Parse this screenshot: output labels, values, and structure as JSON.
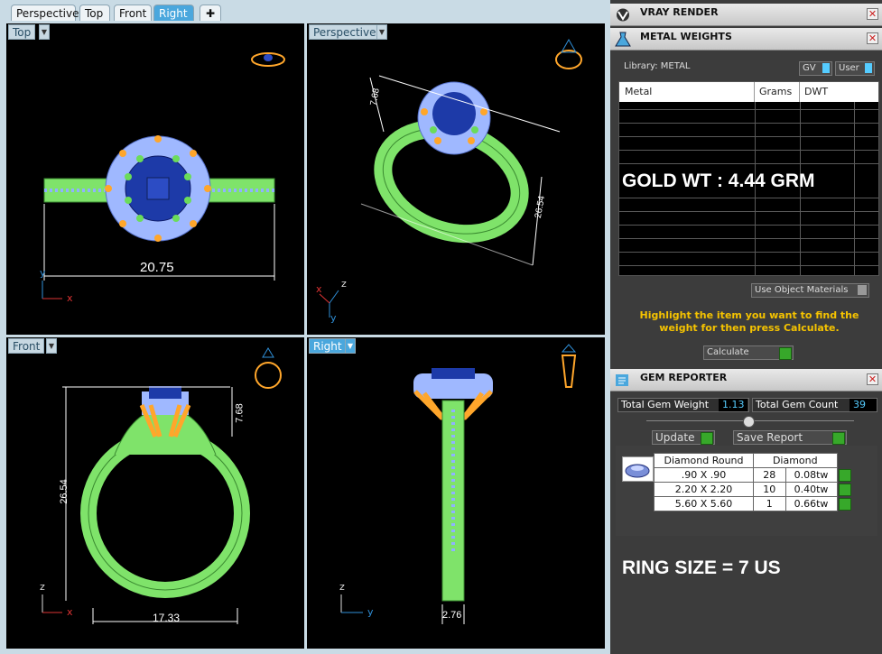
{
  "tabs": [
    {
      "label": "Perspective"
    },
    {
      "label": "Top"
    },
    {
      "label": "Front"
    },
    {
      "label": "Right"
    },
    {
      "label": "✚"
    }
  ],
  "viewports": {
    "top": {
      "label": "Top",
      "dim": "20.75",
      "axis_x": "x",
      "axis_y": "y"
    },
    "perspective": {
      "label": "Perspective",
      "dim_a": "7.68",
      "dim_b": "26.54",
      "axis_x": "x",
      "axis_y": "y",
      "axis_z": "z"
    },
    "front": {
      "label": "Front",
      "dim_height": "26.54",
      "dim_top": "7.68",
      "dim_width": "17.33",
      "axis_x": "x",
      "axis_z": "z"
    },
    "right": {
      "label": "Right",
      "dim_width": "2.76",
      "axis_y": "y",
      "axis_z": "z"
    }
  },
  "vray": {
    "title": "VRAY RENDER",
    "close": "✕"
  },
  "metal": {
    "title": "METAL WEIGHTS",
    "close": "✕",
    "library": "Library: METAL",
    "gv": "GV",
    "user": "User",
    "headers": [
      "Metal",
      "Grams",
      "DWT"
    ],
    "use_object": "Use Object Materials",
    "hint": "Highlight the item you want to find the weight for then press Calculate.",
    "calculate": "Calculate"
  },
  "gem": {
    "title": "GEM REPORTER",
    "close": "✕",
    "total_weight_label": "Total Gem Weight",
    "total_weight": "1.13",
    "total_count_label": "Total Gem Count",
    "total_count": "39",
    "update": "Update",
    "save": "Save Report",
    "headers": [
      "Diamond Round",
      "Diamond"
    ],
    "rows": [
      {
        "size": ".90 X .90",
        "count": "28",
        "tw": "0.08tw"
      },
      {
        "size": "2.20 X 2.20",
        "count": "10",
        "tw": "0.40tw"
      },
      {
        "size": "5.60 X 5.60",
        "count": "1",
        "tw": "0.66tw"
      }
    ]
  },
  "overlay": {
    "gold": "GOLD WT : 4.44 GRM",
    "ring": "RING SIZE = 7 US"
  },
  "colors": {
    "ring": "#8ef07a",
    "gem": "#1d3aa8",
    "halo": "#9fb8ff",
    "prong": "#ffa62b",
    "accent": "#4aa7dd"
  }
}
